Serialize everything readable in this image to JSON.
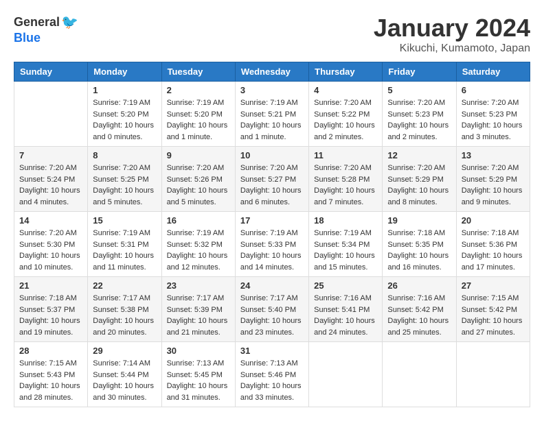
{
  "logo": {
    "general": "General",
    "blue": "Blue"
  },
  "header": {
    "title": "January 2024",
    "location": "Kikuchi, Kumamoto, Japan"
  },
  "days_of_week": [
    "Sunday",
    "Monday",
    "Tuesday",
    "Wednesday",
    "Thursday",
    "Friday",
    "Saturday"
  ],
  "weeks": [
    [
      {
        "day": "",
        "info": ""
      },
      {
        "day": "1",
        "info": "Sunrise: 7:19 AM\nSunset: 5:20 PM\nDaylight: 10 hours\nand 0 minutes."
      },
      {
        "day": "2",
        "info": "Sunrise: 7:19 AM\nSunset: 5:20 PM\nDaylight: 10 hours\nand 1 minute."
      },
      {
        "day": "3",
        "info": "Sunrise: 7:19 AM\nSunset: 5:21 PM\nDaylight: 10 hours\nand 1 minute."
      },
      {
        "day": "4",
        "info": "Sunrise: 7:20 AM\nSunset: 5:22 PM\nDaylight: 10 hours\nand 2 minutes."
      },
      {
        "day": "5",
        "info": "Sunrise: 7:20 AM\nSunset: 5:23 PM\nDaylight: 10 hours\nand 2 minutes."
      },
      {
        "day": "6",
        "info": "Sunrise: 7:20 AM\nSunset: 5:23 PM\nDaylight: 10 hours\nand 3 minutes."
      }
    ],
    [
      {
        "day": "7",
        "info": "Sunrise: 7:20 AM\nSunset: 5:24 PM\nDaylight: 10 hours\nand 4 minutes."
      },
      {
        "day": "8",
        "info": "Sunrise: 7:20 AM\nSunset: 5:25 PM\nDaylight: 10 hours\nand 5 minutes."
      },
      {
        "day": "9",
        "info": "Sunrise: 7:20 AM\nSunset: 5:26 PM\nDaylight: 10 hours\nand 5 minutes."
      },
      {
        "day": "10",
        "info": "Sunrise: 7:20 AM\nSunset: 5:27 PM\nDaylight: 10 hours\nand 6 minutes."
      },
      {
        "day": "11",
        "info": "Sunrise: 7:20 AM\nSunset: 5:28 PM\nDaylight: 10 hours\nand 7 minutes."
      },
      {
        "day": "12",
        "info": "Sunrise: 7:20 AM\nSunset: 5:29 PM\nDaylight: 10 hours\nand 8 minutes."
      },
      {
        "day": "13",
        "info": "Sunrise: 7:20 AM\nSunset: 5:29 PM\nDaylight: 10 hours\nand 9 minutes."
      }
    ],
    [
      {
        "day": "14",
        "info": "Sunrise: 7:20 AM\nSunset: 5:30 PM\nDaylight: 10 hours\nand 10 minutes."
      },
      {
        "day": "15",
        "info": "Sunrise: 7:19 AM\nSunset: 5:31 PM\nDaylight: 10 hours\nand 11 minutes."
      },
      {
        "day": "16",
        "info": "Sunrise: 7:19 AM\nSunset: 5:32 PM\nDaylight: 10 hours\nand 12 minutes."
      },
      {
        "day": "17",
        "info": "Sunrise: 7:19 AM\nSunset: 5:33 PM\nDaylight: 10 hours\nand 14 minutes."
      },
      {
        "day": "18",
        "info": "Sunrise: 7:19 AM\nSunset: 5:34 PM\nDaylight: 10 hours\nand 15 minutes."
      },
      {
        "day": "19",
        "info": "Sunrise: 7:18 AM\nSunset: 5:35 PM\nDaylight: 10 hours\nand 16 minutes."
      },
      {
        "day": "20",
        "info": "Sunrise: 7:18 AM\nSunset: 5:36 PM\nDaylight: 10 hours\nand 17 minutes."
      }
    ],
    [
      {
        "day": "21",
        "info": "Sunrise: 7:18 AM\nSunset: 5:37 PM\nDaylight: 10 hours\nand 19 minutes."
      },
      {
        "day": "22",
        "info": "Sunrise: 7:17 AM\nSunset: 5:38 PM\nDaylight: 10 hours\nand 20 minutes."
      },
      {
        "day": "23",
        "info": "Sunrise: 7:17 AM\nSunset: 5:39 PM\nDaylight: 10 hours\nand 21 minutes."
      },
      {
        "day": "24",
        "info": "Sunrise: 7:17 AM\nSunset: 5:40 PM\nDaylight: 10 hours\nand 23 minutes."
      },
      {
        "day": "25",
        "info": "Sunrise: 7:16 AM\nSunset: 5:41 PM\nDaylight: 10 hours\nand 24 minutes."
      },
      {
        "day": "26",
        "info": "Sunrise: 7:16 AM\nSunset: 5:42 PM\nDaylight: 10 hours\nand 25 minutes."
      },
      {
        "day": "27",
        "info": "Sunrise: 7:15 AM\nSunset: 5:42 PM\nDaylight: 10 hours\nand 27 minutes."
      }
    ],
    [
      {
        "day": "28",
        "info": "Sunrise: 7:15 AM\nSunset: 5:43 PM\nDaylight: 10 hours\nand 28 minutes."
      },
      {
        "day": "29",
        "info": "Sunrise: 7:14 AM\nSunset: 5:44 PM\nDaylight: 10 hours\nand 30 minutes."
      },
      {
        "day": "30",
        "info": "Sunrise: 7:13 AM\nSunset: 5:45 PM\nDaylight: 10 hours\nand 31 minutes."
      },
      {
        "day": "31",
        "info": "Sunrise: 7:13 AM\nSunset: 5:46 PM\nDaylight: 10 hours\nand 33 minutes."
      },
      {
        "day": "",
        "info": ""
      },
      {
        "day": "",
        "info": ""
      },
      {
        "day": "",
        "info": ""
      }
    ]
  ]
}
